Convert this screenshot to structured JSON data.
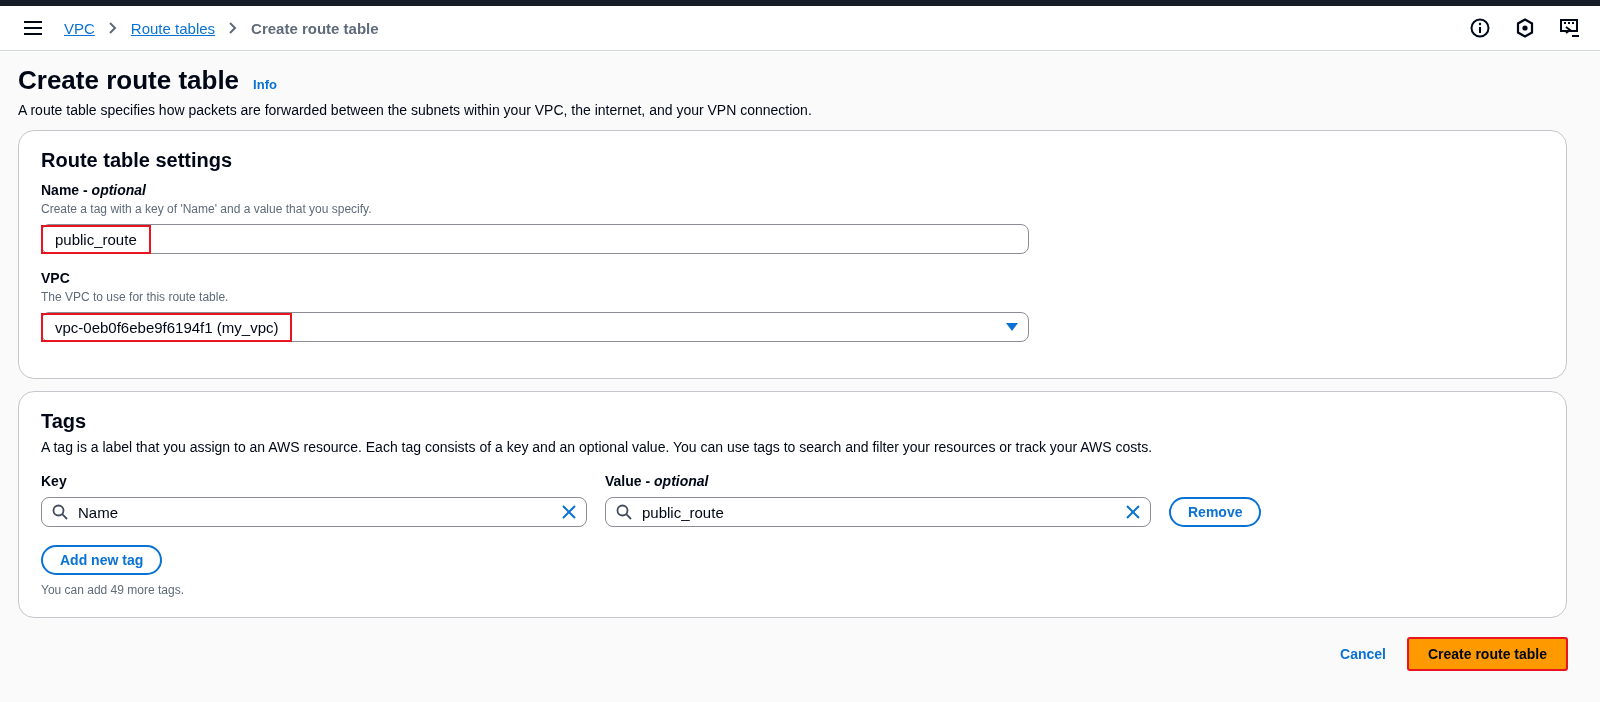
{
  "breadcrumbs": [
    {
      "label": "VPC",
      "link": true
    },
    {
      "label": "Route tables",
      "link": true
    },
    {
      "label": "Create route table",
      "link": false
    }
  ],
  "page": {
    "title": "Create route table",
    "info": "Info",
    "description": "A route table specifies how packets are forwarded between the subnets within your VPC, the internet, and your VPN connection."
  },
  "settings": {
    "title": "Route table settings",
    "fields": [
      {
        "kind": "text",
        "label": "Name - *optional*",
        "hint": "Create a tag with a key of 'Name' and a value that you specify.",
        "value": "public_route",
        "highlighted": true
      },
      {
        "kind": "select",
        "label": "VPC",
        "hint": "The VPC to use for this route table.",
        "value": "vpc-0eb0f6ebe9f6194f1 (my_vpc)",
        "highlighted": true
      }
    ]
  },
  "tags": {
    "title": "Tags",
    "description": "A tag is a label that you assign to an AWS resource. Each tag consists of a key and an optional value. You can use tags to search and filter your resources or track your AWS costs.",
    "key_label": "Key",
    "value_label": "Value - *optional*",
    "rows": [
      {
        "key": "Name",
        "value": "public_route",
        "remove": "Remove"
      }
    ],
    "add_button": "Add new tag",
    "limit_note": "You can add 49 more tags."
  },
  "actions": {
    "cancel": "Cancel",
    "submit": "Create route table",
    "submit_highlighted": true
  }
}
